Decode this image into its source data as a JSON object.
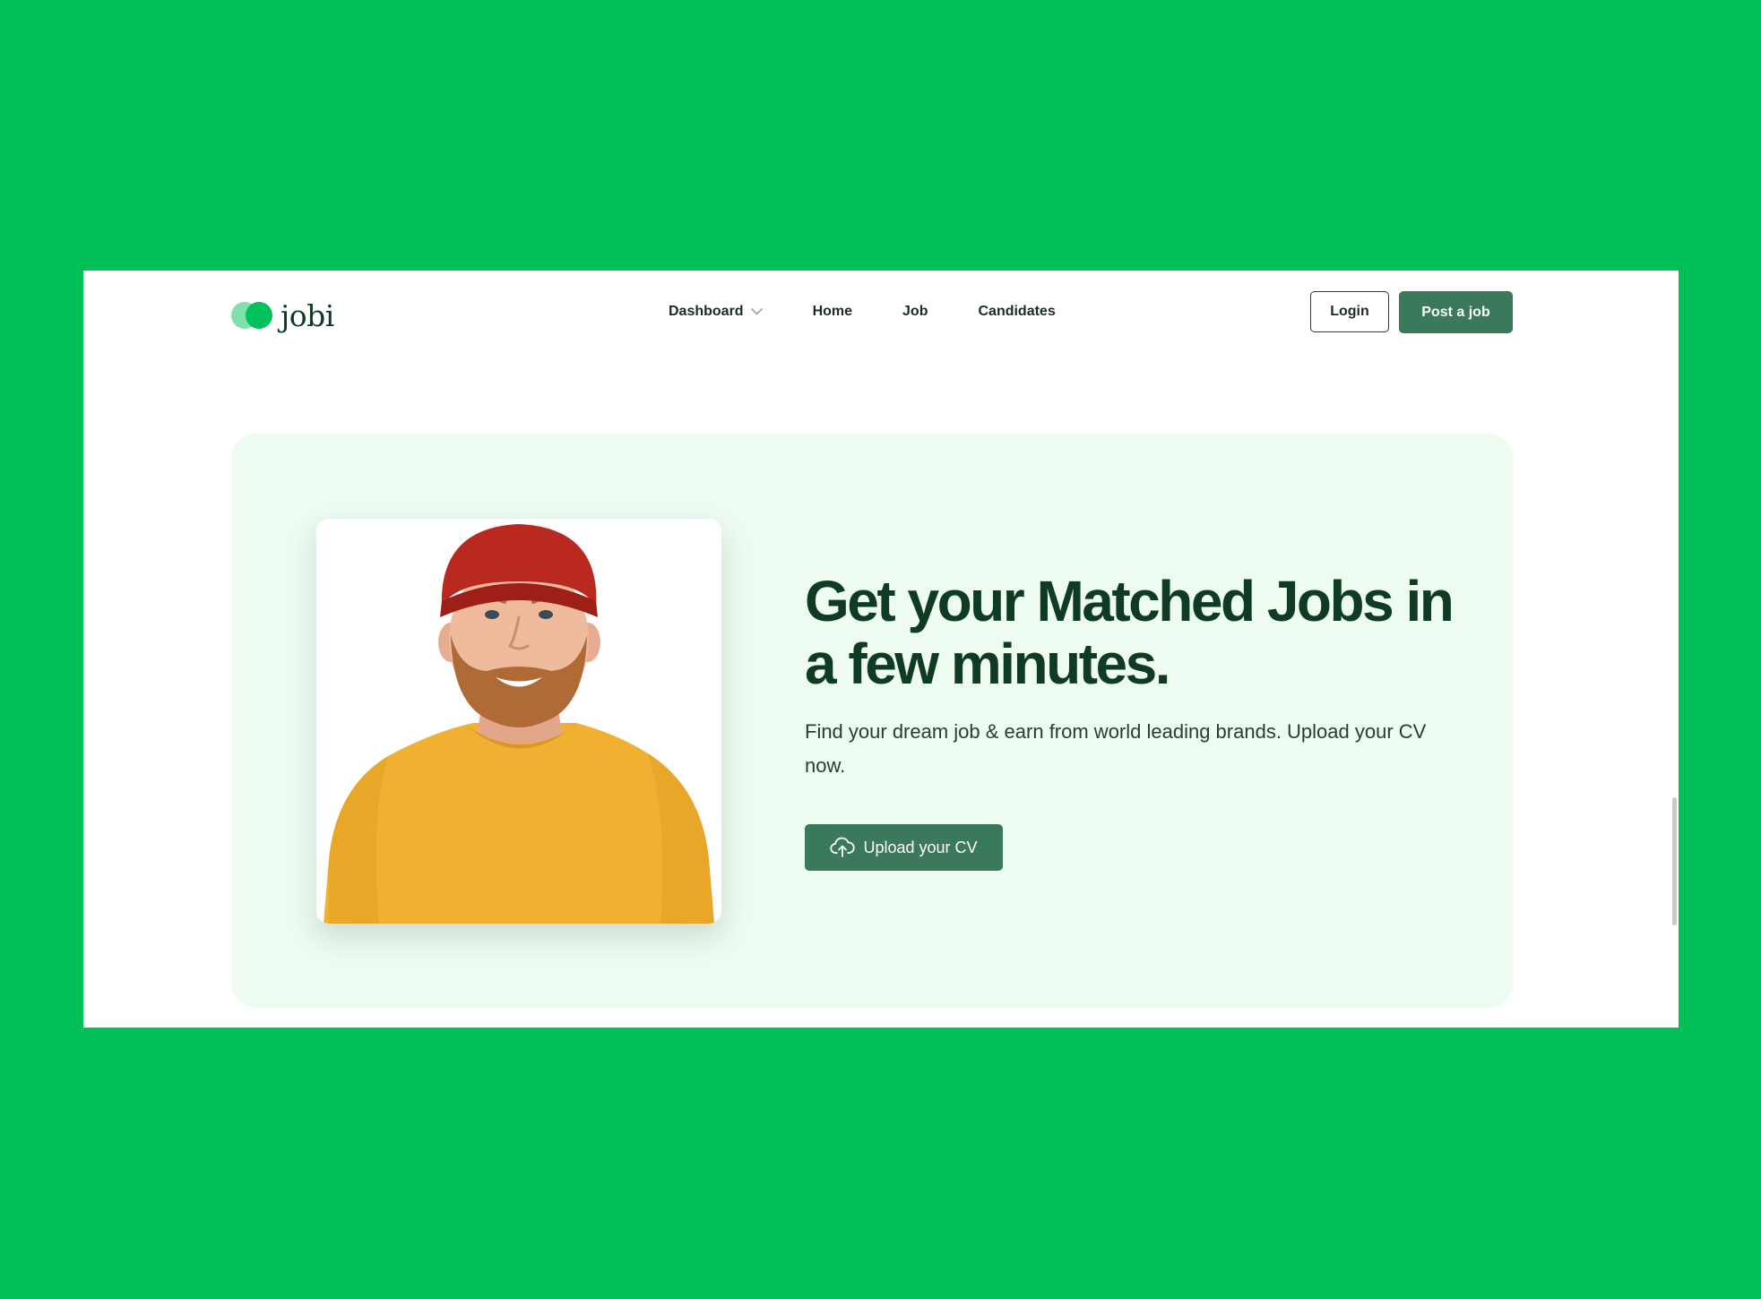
{
  "brand": {
    "name": "jobi",
    "primary_color": "#3a7a5b",
    "logo_colors": [
      "#7fe0a9",
      "#00c25c"
    ],
    "page_background": "#00BF56",
    "hero_background": "#edfbf1"
  },
  "nav": {
    "items": [
      {
        "label": "Dashboard",
        "has_dropdown": true
      },
      {
        "label": "Home"
      },
      {
        "label": "Job"
      },
      {
        "label": "Candidates"
      }
    ]
  },
  "header": {
    "login_label": "Login",
    "post_job_label": "Post a job"
  },
  "hero": {
    "headline": "Get your Matched Jobs in a few minutes.",
    "subtext": "Find your dream job & earn from world leading brands. Upload your CV now.",
    "upload_label": "Upload your CV",
    "upload_icon": "cloud-upload-icon",
    "photo": "smiling man in red beanie and yellow sweater"
  }
}
